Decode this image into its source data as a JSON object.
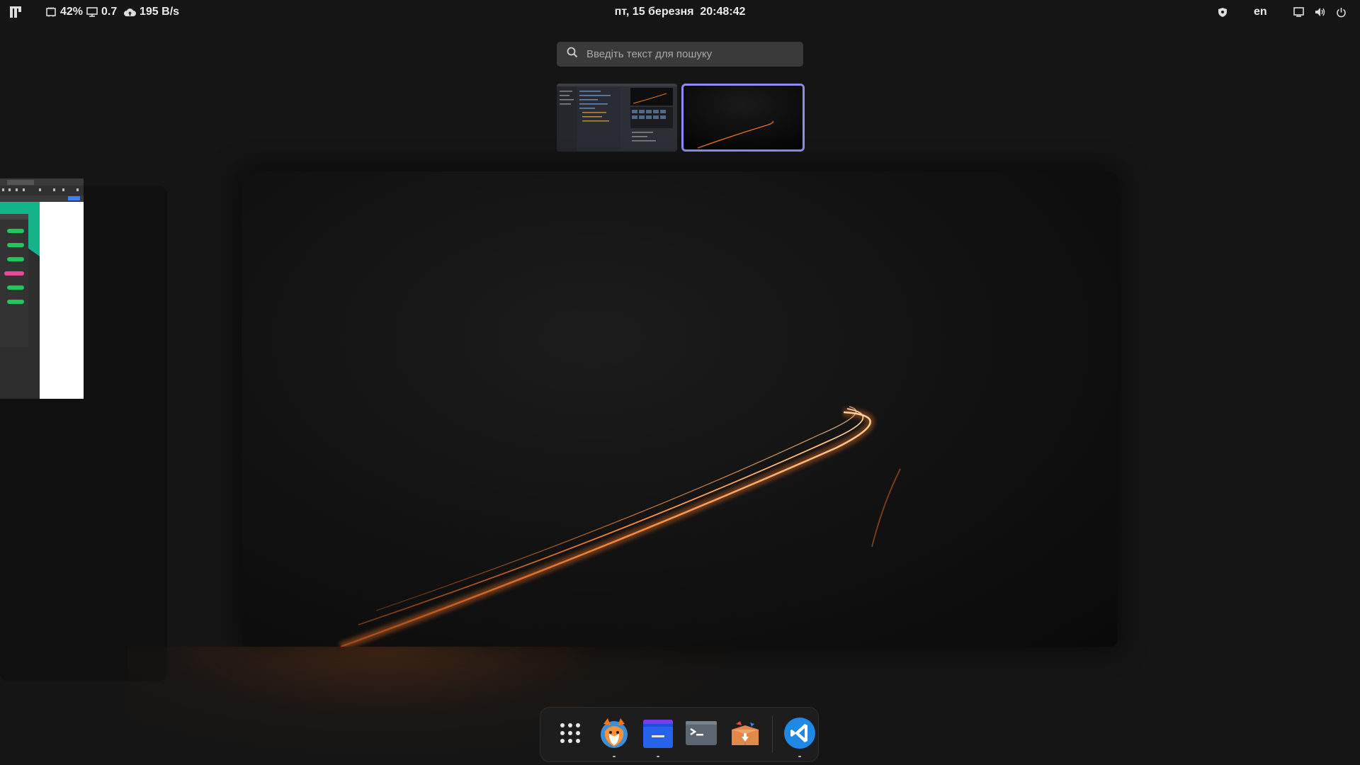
{
  "topbar": {
    "activities_icon": "app-grid-logo-icon",
    "cpu": "42%",
    "load": "0.7",
    "network": "195 B/s",
    "datetime": "пт, 15 березня  20:48:42",
    "language": "en",
    "tray_icons": [
      "shield-icon",
      "screen-icon",
      "volume-icon",
      "power-icon"
    ]
  },
  "search": {
    "placeholder": "Введіть текст для пошуку"
  },
  "workspaces": [
    {
      "label": "",
      "active": false
    },
    {
      "label": "",
      "active": true
    }
  ],
  "dock": {
    "items": [
      {
        "name": "show-apps",
        "icon": "app-grid-icon"
      },
      {
        "name": "firefox",
        "icon": "firefox-icon"
      },
      {
        "name": "files",
        "icon": "files-icon"
      },
      {
        "name": "terminal",
        "icon": "terminal-icon"
      },
      {
        "name": "software",
        "icon": "software-store-icon"
      },
      {
        "name": "vscode",
        "icon": "vscode-icon"
      }
    ]
  },
  "colors": {
    "accent": "#8d8cf0",
    "light_trail": "#ff8a3a",
    "background": "#151515"
  }
}
